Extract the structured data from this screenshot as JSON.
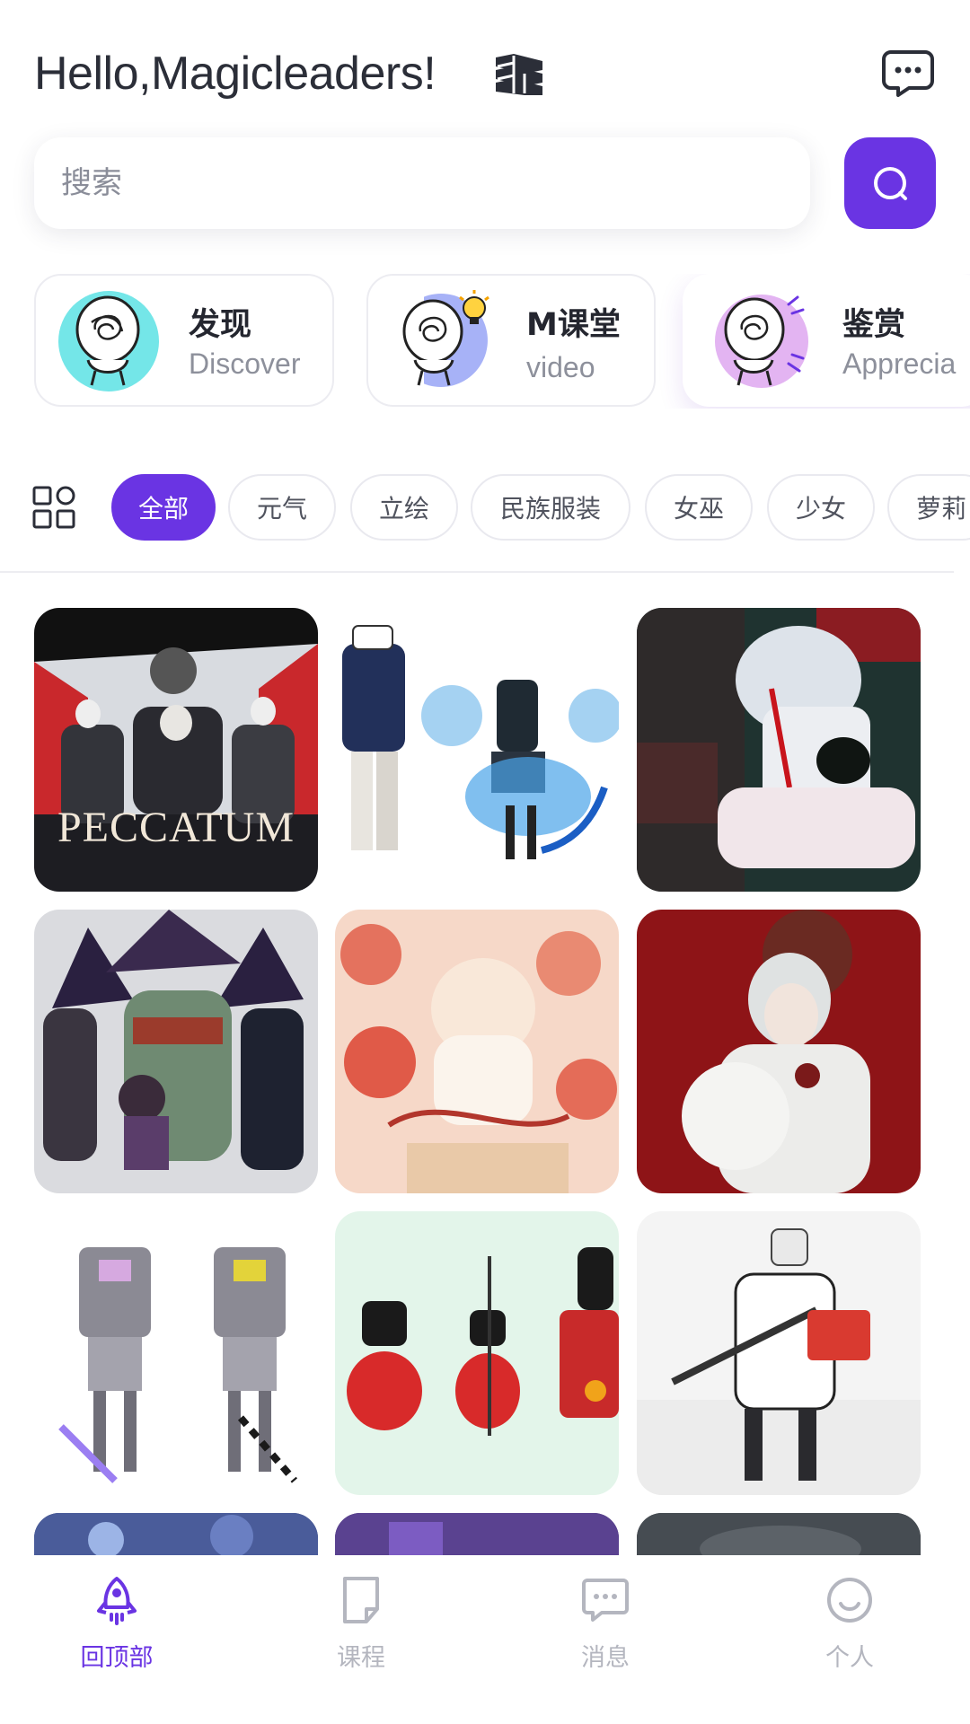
{
  "header": {
    "greeting": "Hello,Magicleaders!"
  },
  "search": {
    "placeholder": "搜索"
  },
  "entries": [
    {
      "title": "发现",
      "subtitle": "Discover",
      "avatar_color": "#74e6e8"
    },
    {
      "title": "M课堂",
      "subtitle": "video",
      "avatar_color": "#a7b2f7"
    },
    {
      "title": "鉴赏",
      "subtitle": "Apprecia",
      "avatar_color": "#e3b4f2"
    }
  ],
  "tabs": [
    "全部",
    "元气",
    "立绘",
    "民族服装",
    "女巫",
    "少女",
    "萝莉"
  ],
  "active_tab": 0,
  "gallery": {
    "tiles": [
      {
        "caption": "PECCATUM"
      }
    ]
  },
  "bottom_nav": [
    {
      "label": "回顶部",
      "icon": "rocket-icon"
    },
    {
      "label": "课程",
      "icon": "document-icon"
    },
    {
      "label": "消息",
      "icon": "message-icon"
    },
    {
      "label": "个人",
      "icon": "smiley-icon"
    }
  ],
  "colors": {
    "accent": "#6a34e3",
    "inactive_nav": "#b4b6bf"
  }
}
